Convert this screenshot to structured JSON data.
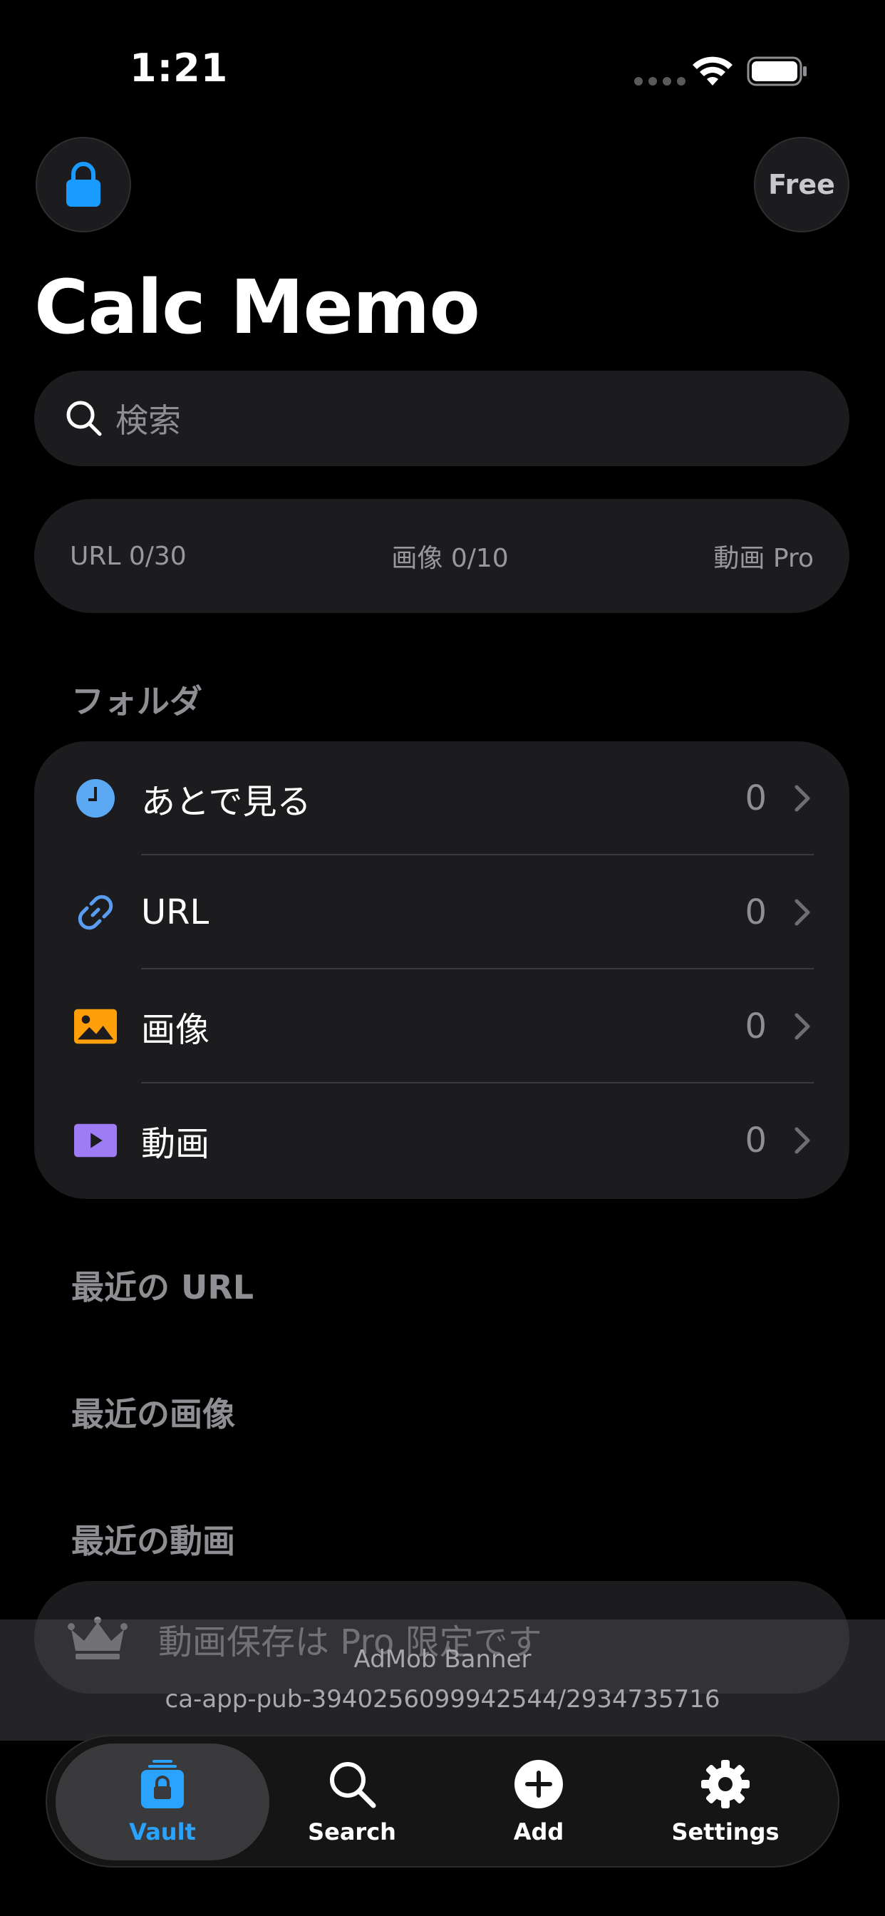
{
  "status_bar": {
    "time": "1:21"
  },
  "header": {
    "free_label": "Free",
    "title": "Calc Memo"
  },
  "search": {
    "placeholder": "検索"
  },
  "quota": {
    "url": "URL 0/30",
    "image": "画像 0/10",
    "video": "動画 Pro"
  },
  "folders": {
    "heading": "フォルダ",
    "items": [
      {
        "label": "あとで見る",
        "count": "0",
        "icon": "clock-icon",
        "color": "#5aa9f2"
      },
      {
        "label": "URL",
        "count": "0",
        "icon": "link-icon",
        "color": "#5a9cf0"
      },
      {
        "label": "画像",
        "count": "0",
        "icon": "photo-icon",
        "color": "#ff9f0a"
      },
      {
        "label": "動画",
        "count": "0",
        "icon": "play-icon",
        "color": "#9d7cf5"
      }
    ]
  },
  "sections": {
    "recent_url": "最近の URL",
    "recent_images": "最近の画像",
    "recent_videos": "最近の動画"
  },
  "pro_banner": {
    "text": "動画保存は Pro 限定です"
  },
  "ad": {
    "title": "AdMob Banner",
    "unit_id": "ca-app-pub-3940256099942544/2934735716"
  },
  "tabbar": {
    "tabs": [
      {
        "label": "Vault",
        "active": true
      },
      {
        "label": "Search",
        "active": false
      },
      {
        "label": "Add",
        "active": false
      },
      {
        "label": "Settings",
        "active": false
      }
    ]
  },
  "colors": {
    "accent": "#2aa3ff",
    "background": "#000000",
    "card": "#1c1c1e"
  }
}
